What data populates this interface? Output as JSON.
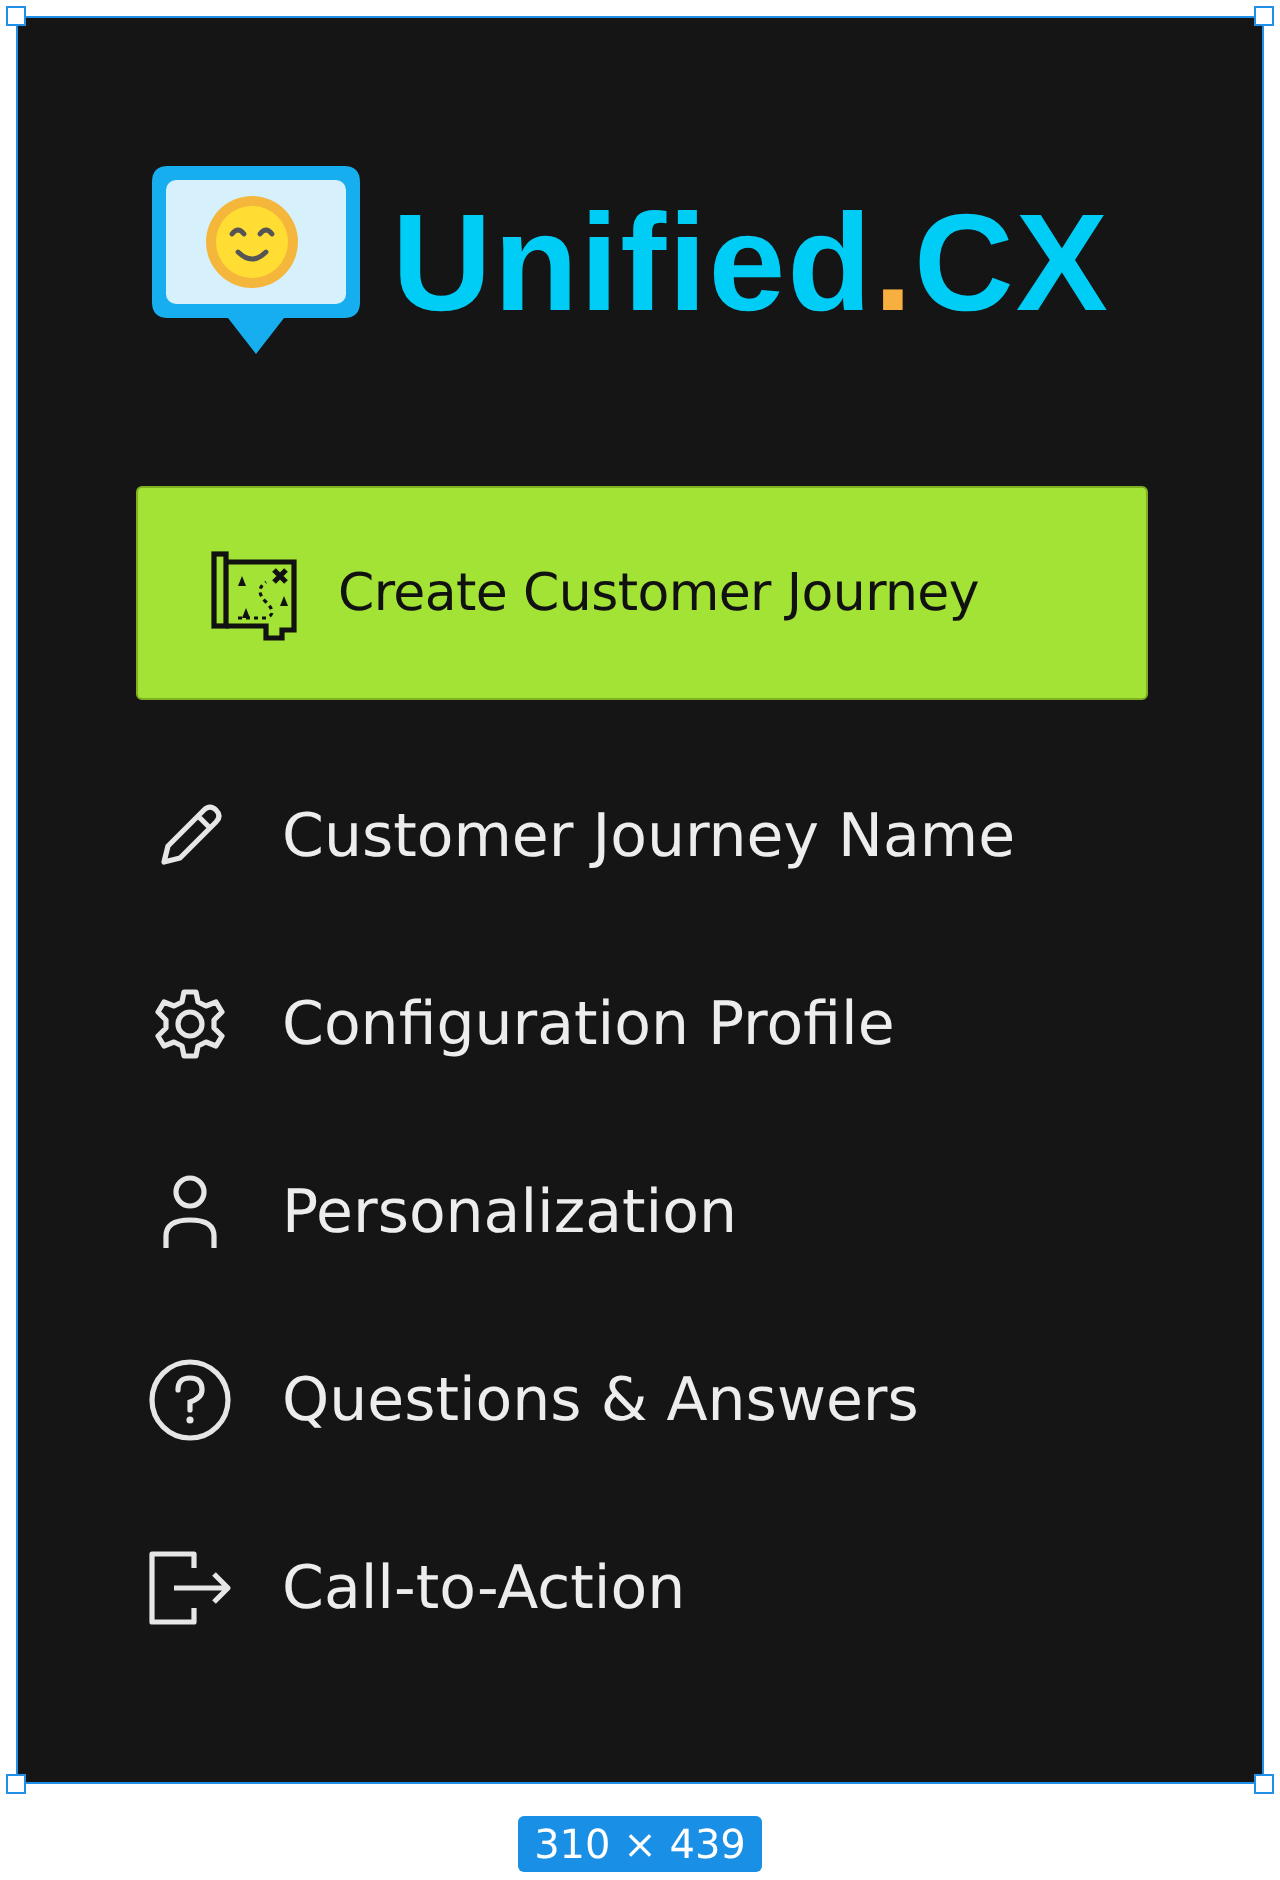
{
  "logo": {
    "name": "Unified",
    "separator": ".",
    "suffix": "CX"
  },
  "primary_button": {
    "label": "Create Customer Journey"
  },
  "menu": [
    {
      "kind": "pencil",
      "label": "Customer Journey Name"
    },
    {
      "kind": "gear",
      "label": "Configuration Profile"
    },
    {
      "kind": "person",
      "label": "Personalization"
    },
    {
      "kind": "question",
      "label": "Questions & Answers"
    },
    {
      "kind": "exit",
      "label": "Call-to-Action"
    }
  ],
  "selection": {
    "size": "310 × 439"
  }
}
